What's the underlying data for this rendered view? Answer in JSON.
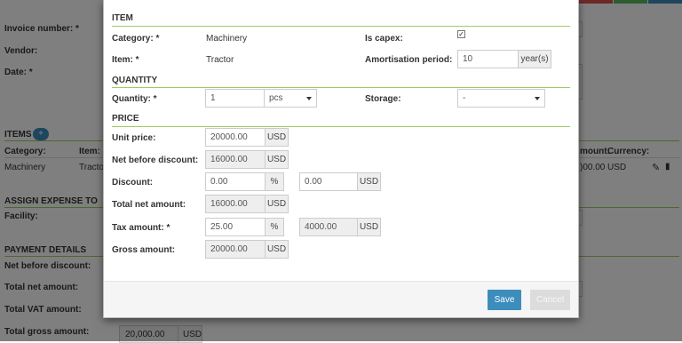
{
  "background": {
    "labels": {
      "invoice_number": "Invoice number: *",
      "vendor": "Vendor:",
      "date": "Date: *"
    },
    "items_section": {
      "title": "ITEMS",
      "add_icon": "plus-icon",
      "columns": [
        "Category:",
        "Item:"
      ],
      "right_columns": [
        "mount:",
        "Currency:"
      ],
      "row": {
        "category": "Machinery",
        "item": "Tracto",
        "amount": ")00.00",
        "currency": "USD"
      }
    },
    "assign_expense": {
      "title": "ASSIGN EXPENSE TO",
      "facility": "Facility:"
    },
    "payment_details": {
      "title": "PAYMENT DETAILS",
      "net_before_discount": "Net before discount:",
      "total_net_amount": "Total net amount:",
      "total_vat_amount": "Total VAT amount:",
      "total_gross_amount": "Total gross amount:",
      "gross_value": "20,000.00",
      "gross_currency": "USD"
    },
    "colors": {
      "top_buttons": [
        "#d9534f",
        "#5cb85c",
        "#3c8dbc"
      ]
    }
  },
  "modal": {
    "item_section": {
      "title": "ITEM",
      "category_label": "Category: *",
      "category_value": "Machinery",
      "is_capex_label": "Is capex:",
      "is_capex_checked": true,
      "item_label": "Item: *",
      "item_value": "Tractor",
      "amortisation_label": "Amortisation period:",
      "amortisation_value": "10",
      "amortisation_unit": "year(s)"
    },
    "quantity_section": {
      "title": "QUANTITY",
      "quantity_label": "Quantity: *",
      "quantity_value": "1",
      "unit_value": "pcs",
      "storage_label": "Storage:",
      "storage_value": "-"
    },
    "price_section": {
      "title": "PRICE",
      "unit_price_label": "Unit price:",
      "unit_price_value": "20000.00",
      "unit_price_currency": "USD",
      "net_before_discount_label": "Net before discount:",
      "net_before_discount_value": "16000.00",
      "net_before_discount_currency": "USD",
      "discount_label": "Discount:",
      "discount_percent_value": "0.00",
      "discount_percent_unit": "%",
      "discount_amount_value": "0.00",
      "discount_amount_currency": "USD",
      "total_net_label": "Total net amount:",
      "total_net_value": "16000.00",
      "total_net_currency": "USD",
      "tax_label": "Tax amount: *",
      "tax_percent_value": "25.00",
      "tax_percent_unit": "%",
      "tax_amount_value": "4000.00",
      "tax_amount_currency": "USD",
      "gross_label": "Gross amount:",
      "gross_value": "20000.00",
      "gross_currency": "USD"
    },
    "footer": {
      "save_label": "Save",
      "cancel_label": "Cancel"
    },
    "colors": {
      "accent": "#3c8dbc",
      "section_line": "#9ccc65"
    }
  }
}
